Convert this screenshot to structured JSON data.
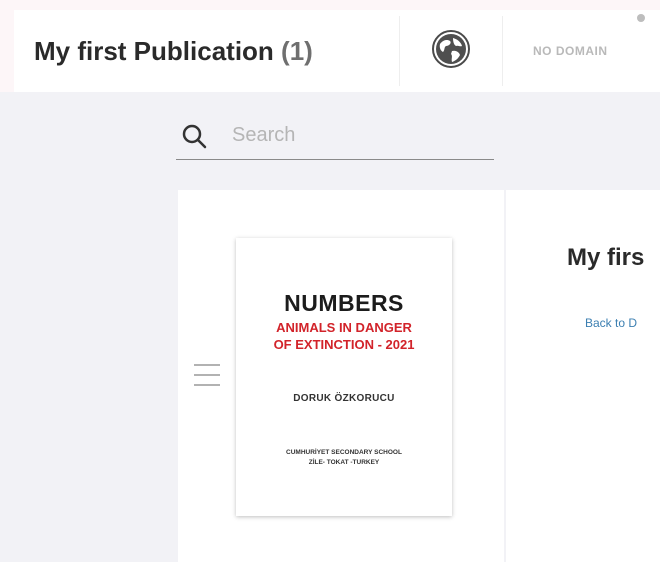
{
  "header": {
    "title": "My first Publication",
    "count": "(1)",
    "globe_icon": "globe-icon",
    "domain_label": "NO DOMAIN"
  },
  "search": {
    "placeholder": "Search",
    "value": "",
    "icon": "search-icon"
  },
  "publication": {
    "cover": {
      "title": "NUMBERS",
      "subtitle": "ANIMALS IN DANGER\nOF EXTINCTION - 2021",
      "author": "DORUK ÖZKORUCU",
      "school": "CUMHURİYET SECONDARY SCHOOL\nZİLE- TOKAT -TURKEY"
    },
    "drag_icon": "drag-handle-icon",
    "detail_title": "My firs",
    "back_link": "Back to D"
  },
  "colors": {
    "accent_link": "#3c7fb1",
    "cover_subtitle": "#d2232a",
    "background": "#f2f2f6"
  }
}
